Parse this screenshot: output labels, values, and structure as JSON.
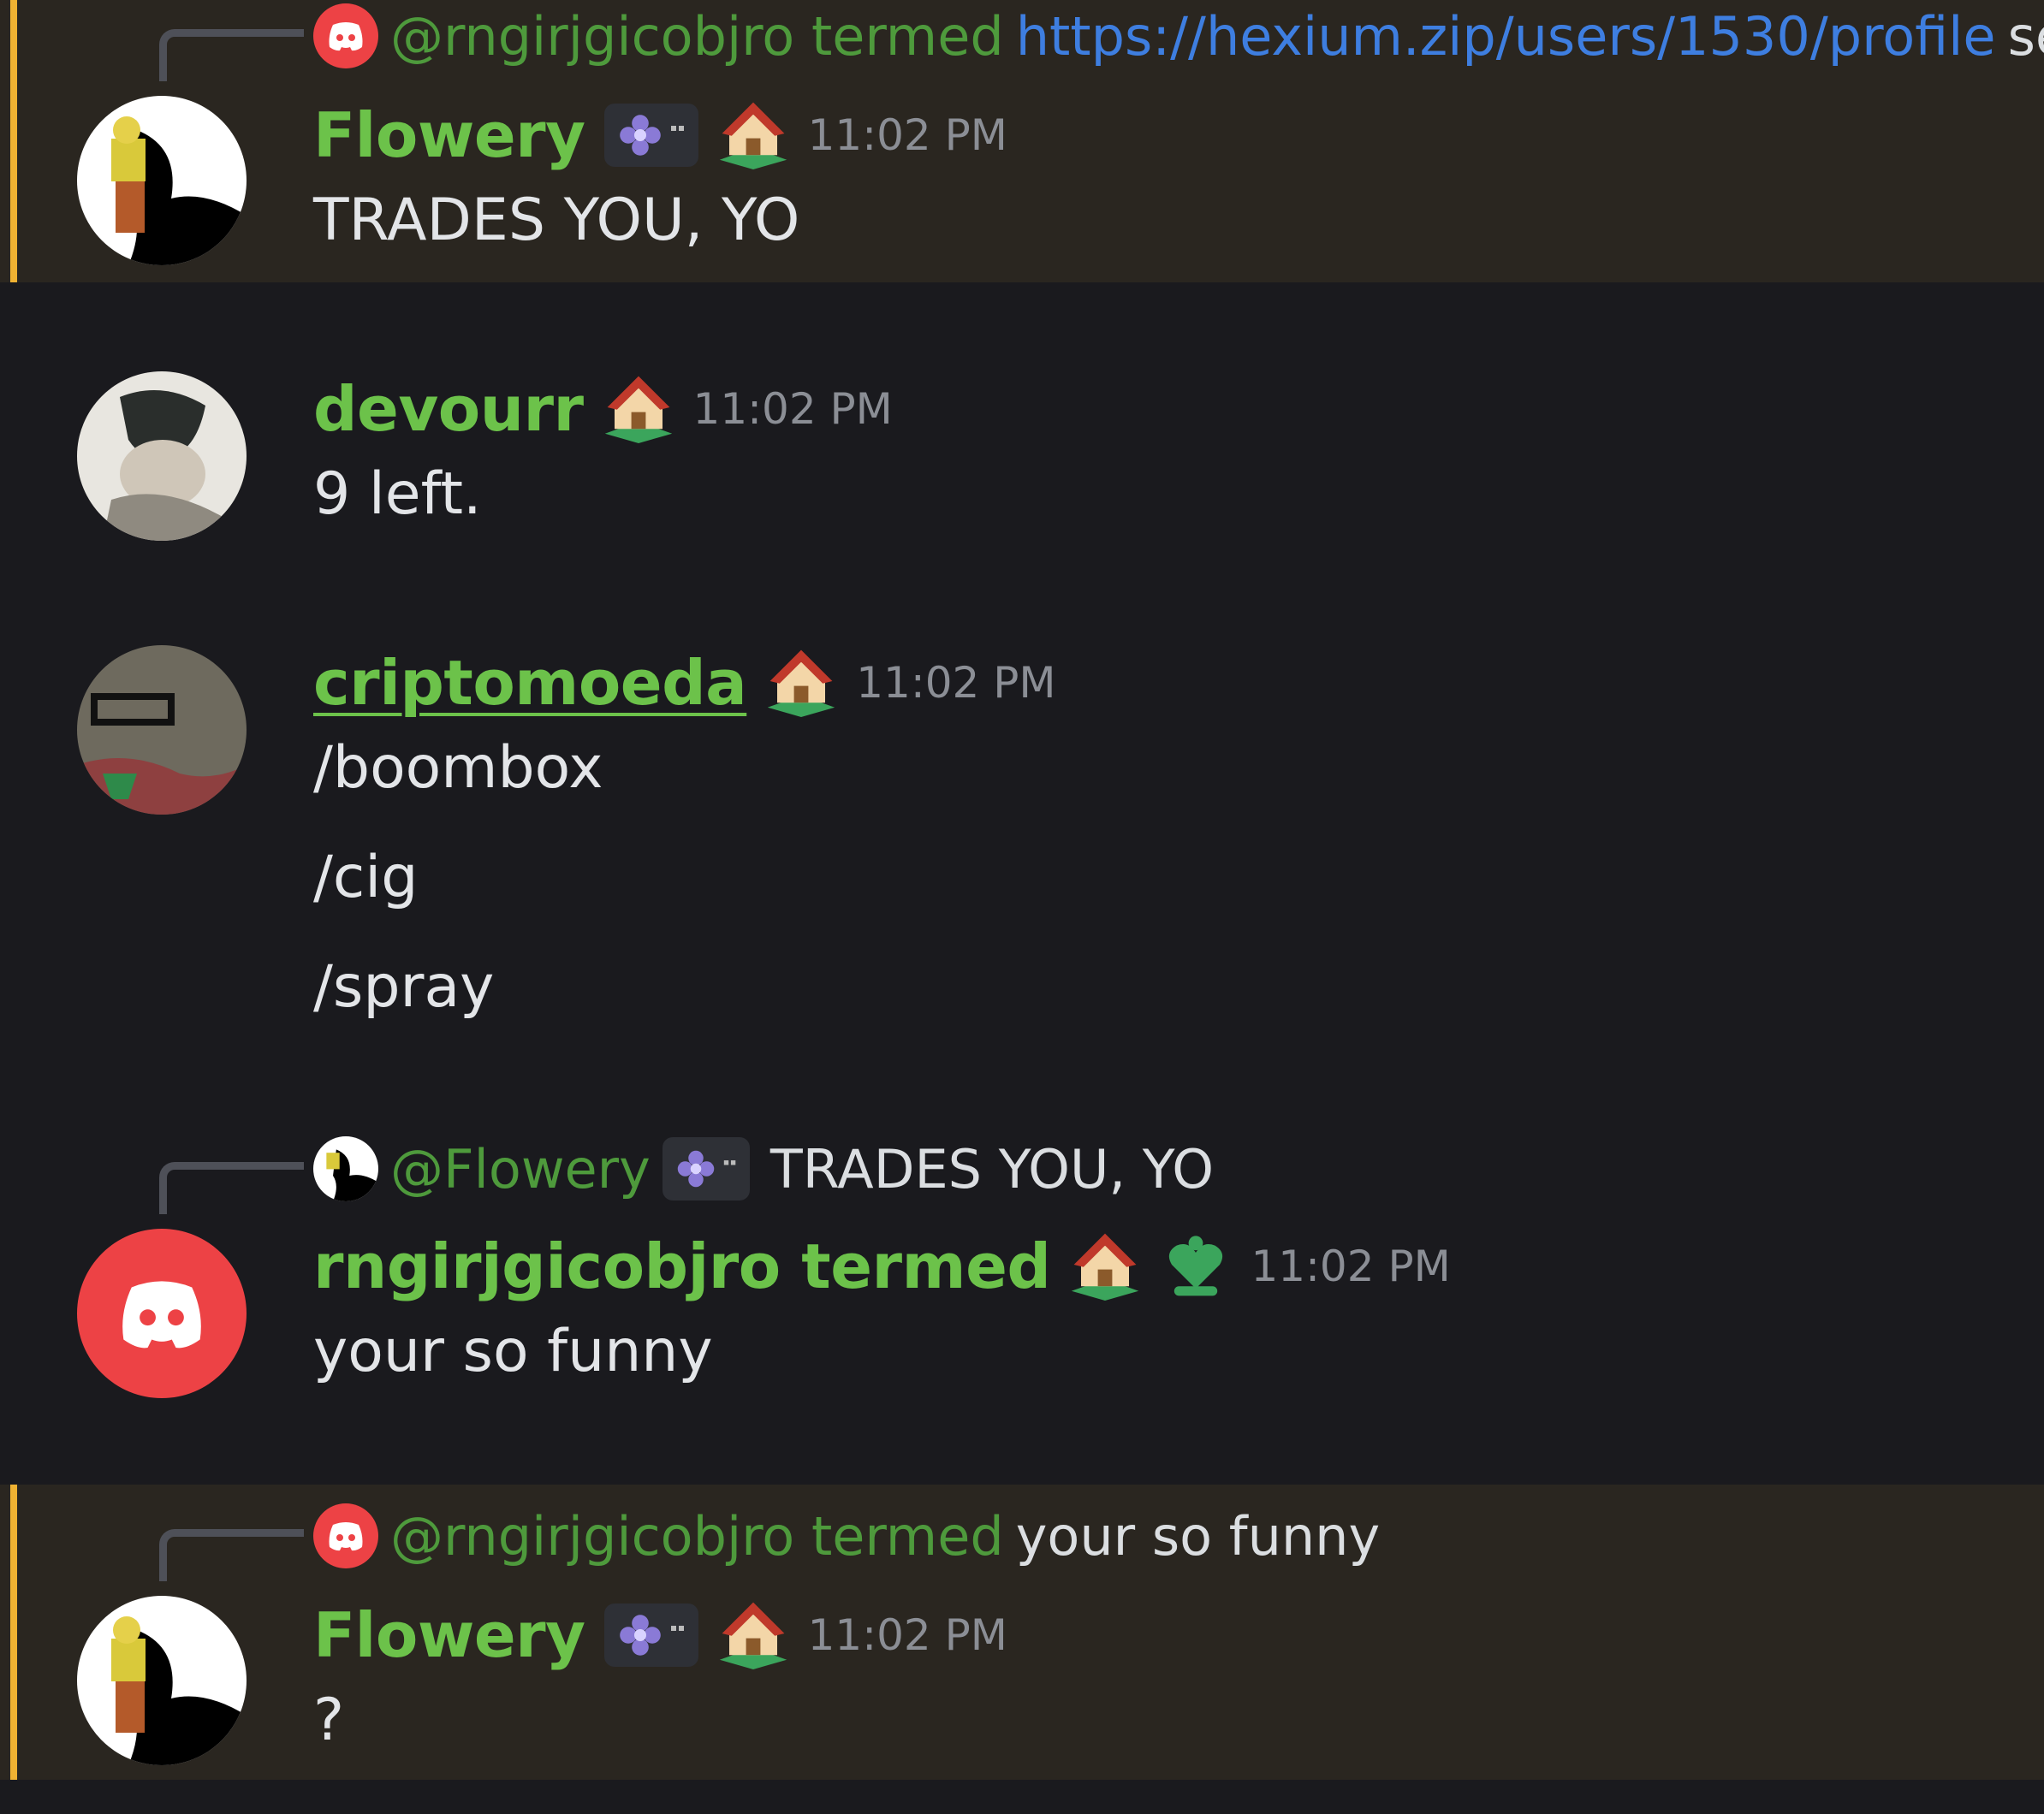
{
  "messages": [
    {
      "reply": {
        "name": "@rngirjgicobjro termed",
        "link": "https://hexium.zip/users/1530/profile",
        "text": "sen"
      },
      "author": "Flowery",
      "time": "11:02 PM",
      "lines": [
        "TRADES YOU, YO"
      ]
    },
    {
      "author": "devourr",
      "time": "11:02 PM",
      "lines": [
        "9 left."
      ]
    },
    {
      "author": "criptomoeda",
      "time": "11:02 PM",
      "lines": [
        "/boombox",
        "/cig",
        "/spray"
      ]
    },
    {
      "reply": {
        "name": "@Flowery",
        "text": "TRADES YOU, YO"
      },
      "author": "rngirjgicobjro termed",
      "time": "11:02 PM",
      "lines": [
        "your so funny"
      ]
    },
    {
      "reply": {
        "name": "@rngirjgicobjro termed",
        "text": "your so funny"
      },
      "author": "Flowery",
      "time": "11:02 PM",
      "lines": [
        "?"
      ]
    }
  ],
  "colors": {
    "mention_bg": "#2a2620",
    "mention_bar": "#f0b232",
    "username": "#6cc24a",
    "link": "#3e7ee0",
    "discord_red": "#ed4245"
  },
  "icons": [
    "discord-icon",
    "house-role-icon",
    "flower-badge-icon",
    "heart-role-icon"
  ]
}
